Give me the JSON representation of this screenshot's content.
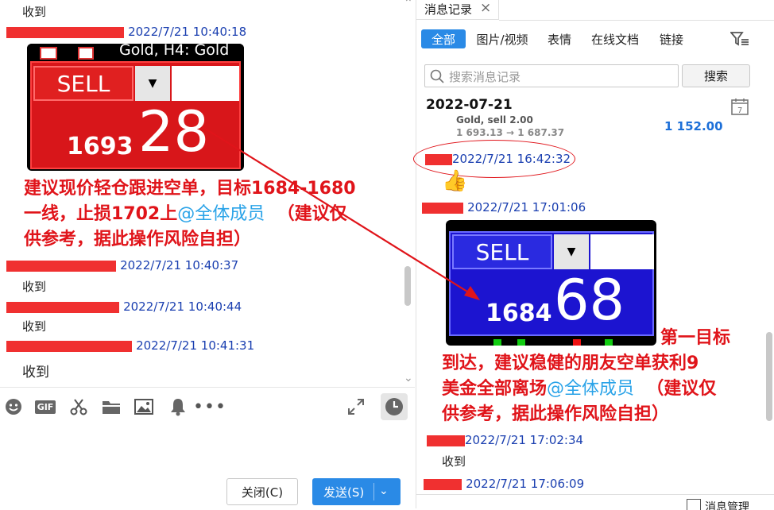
{
  "left": {
    "messages": [
      {
        "text": "收到"
      },
      {
        "time": "2022/7/21 10:40:18"
      },
      {
        "time": "2022/7/21 10:40:37",
        "text": "收到"
      },
      {
        "time": "2022/7/21 10:40:44",
        "text": "收到"
      },
      {
        "time": "2022/7/21 10:41:31",
        "text": "收到"
      }
    ],
    "trade_image": {
      "header": "Gold, H4:  Gold",
      "sell": "SELL",
      "price_small": "1693",
      "price_big": "28",
      "bg": "#d8161a"
    },
    "note": {
      "line1": "建议现价轻仓跟进空单，目标1684-1680",
      "line2a": "一线，止损1702上",
      "mention": "@全体成员",
      "line2b": "（建议仅",
      "line3": "供参考，据此操作风险自担）"
    },
    "toolbar_icons": [
      "emoji-icon",
      "gif-icon",
      "scissors-icon",
      "folder-icon",
      "image-icon",
      "bell-icon",
      "more-icon",
      "expand-icon",
      "history-icon"
    ],
    "gif_label": "GIF",
    "close_label": "关闭(C)",
    "send_label": "发送(S)"
  },
  "right": {
    "tab_title": "消息记录",
    "close_icon": "×",
    "filters": [
      "全部",
      "图片/视频",
      "表情",
      "在线文档",
      "链接"
    ],
    "search_placeholder": "搜索消息记录",
    "search_button": "搜索",
    "date_heading": "2022-07-21",
    "cropped_card": {
      "line1": "Gold, sell 2.00",
      "line2": "1 693.13 → 1 687.37",
      "amount": "1 152.00"
    },
    "messages": [
      {
        "time": "2022/7/21 16:42:32"
      },
      {
        "time": "2022/7/21 17:01:06"
      },
      {
        "time": "2022/7/21 17:02:34",
        "text": "收到"
      },
      {
        "time": "2022/7/21 17:06:09"
      }
    ],
    "trade_image": {
      "sell": "SELL",
      "price_small": "1684",
      "price_big": "68",
      "bg": "#1c14d0"
    },
    "note": {
      "line1": "第一目标",
      "line2": "到达，建议稳健的朋友空单获利9",
      "line3a": "美金全部离场",
      "mention": "@全体成员",
      "line3b": "（建议仅",
      "line4": "供参考，据此操作风险自担）"
    },
    "footer_label": "消息管理"
  },
  "colors": {
    "accent": "#2a8ae6",
    "red": "#e0141a",
    "time_blue": "#1a3fb0",
    "mention": "#2aa3e8"
  }
}
